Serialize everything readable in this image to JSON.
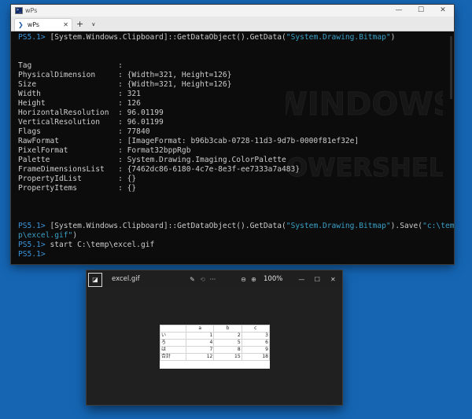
{
  "terminal": {
    "window_title": "wPs",
    "controls": {
      "minimize": "—",
      "maximize": "☐",
      "close": "✕"
    },
    "tab": {
      "label": "wPs",
      "close": "✕",
      "add": "+",
      "dropdown": "∨"
    },
    "lines": [
      [
        {
          "t": "PS5.1> ",
          "c": "prompt"
        },
        {
          "t": "[System.Windows.Clipboard]::GetDataObject().GetData("
        },
        {
          "t": "\"System.Drawing.Bitmap\"",
          "c": "str"
        },
        {
          "t": ")"
        }
      ],
      [],
      [],
      [
        {
          "t": "Tag                   :"
        }
      ],
      [
        {
          "t": "PhysicalDimension     : {Width=321, Height=126}"
        }
      ],
      [
        {
          "t": "Size                  : {Width=321, Height=126}"
        }
      ],
      [
        {
          "t": "Width                 : 321"
        }
      ],
      [
        {
          "t": "Height                : 126"
        }
      ],
      [
        {
          "t": "HorizontalResolution  : 96.01199"
        }
      ],
      [
        {
          "t": "VerticalResolution    : 96.01199"
        }
      ],
      [
        {
          "t": "Flags                 : 77840"
        }
      ],
      [
        {
          "t": "RawFormat             : [ImageFormat: b96b3cab-0728-11d3-9d7b-0000f81ef32e]"
        }
      ],
      [
        {
          "t": "PixelFormat           : Format32bppRgb"
        }
      ],
      [
        {
          "t": "Palette               : System.Drawing.Imaging.ColorPalette"
        }
      ],
      [
        {
          "t": "FrameDimensionsList   : {7462dc86-6180-4c7e-8e3f-ee7333a7a483}"
        }
      ],
      [
        {
          "t": "PropertyIdList        : {}"
        }
      ],
      [
        {
          "t": "PropertyItems         : {}"
        }
      ],
      [],
      [],
      [],
      [
        {
          "t": "PS5.1> ",
          "c": "prompt"
        },
        {
          "t": "[System.Windows.Clipboard]::GetDataObject().GetData("
        },
        {
          "t": "\"System.Drawing.Bitmap\"",
          "c": "str"
        },
        {
          "t": ").Save("
        },
        {
          "t": "\"c:\\tem",
          "c": "str"
        }
      ],
      [
        {
          "t": "p\\excel.gif\"",
          "c": "str"
        },
        {
          "t": ")"
        }
      ],
      [
        {
          "t": "PS5.1> ",
          "c": "prompt"
        },
        {
          "t": "start C:\\temp\\excel.gif"
        }
      ],
      [
        {
          "t": "PS5.1> ",
          "c": "prompt"
        }
      ]
    ],
    "watermark_lines": [
      "WINDOWS",
      "POWERSHELL"
    ]
  },
  "viewer": {
    "filename": "excel.gif",
    "zoom": "100%",
    "tools": {
      "edit": "✎",
      "rotate": "⟲",
      "more": "···",
      "zoom_out": "⊖",
      "zoom_in": "⊕"
    },
    "controls": {
      "minimize": "—",
      "maximize": "☐",
      "close": "✕"
    },
    "image_table": {
      "headers": [
        "",
        "a",
        "b",
        "c"
      ],
      "rows": [
        [
          "い",
          "1",
          "2",
          "3"
        ],
        [
          "ろ",
          "4",
          "5",
          "6"
        ],
        [
          "は",
          "7",
          "8",
          "9"
        ],
        [
          "合計",
          "12",
          "15",
          "18"
        ]
      ]
    }
  },
  "colors": {
    "desktop": "#1565b3",
    "terminal_bg": "#0c0c0c",
    "prompt": "#3a96dd",
    "string": "#3aa0c8"
  }
}
